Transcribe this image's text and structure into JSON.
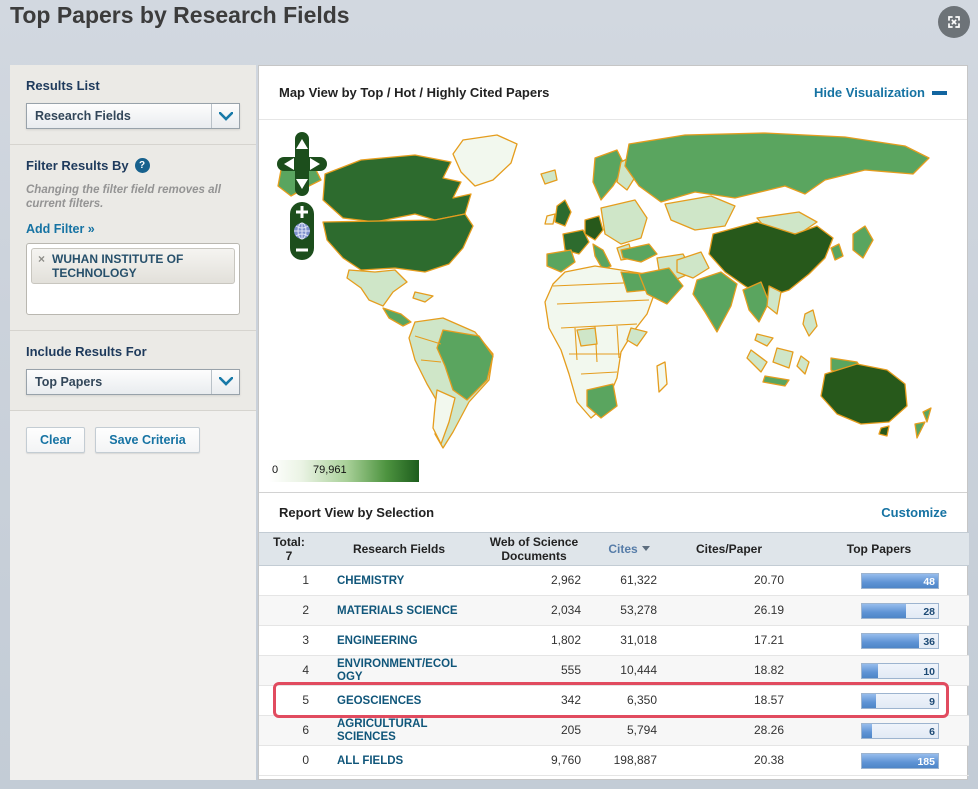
{
  "page": {
    "title": "Top Papers by Research Fields"
  },
  "theme": {
    "link": "#1673a3",
    "highlight": "#e14b5f",
    "nav-heading": "#1e3a5c",
    "field-link": "#10567a"
  },
  "icons": {
    "help": "?",
    "remove_tag": "×",
    "fullscreen": "expand-toggle",
    "hide_minus": "collapse-minus",
    "sort_desc": "triangle-down",
    "chevron_down": "chevron-down"
  },
  "sidebar": {
    "results_list": {
      "heading": "Results List",
      "selected": "Research Fields"
    },
    "filter": {
      "heading": "Filter Results By",
      "note": "Changing the filter field removes all current filters.",
      "add_filter_label": "Add Filter »",
      "tags": [
        {
          "remove_glyph": "×",
          "label": "WUHAN INSTITUTE OF TECHNOLOGY"
        }
      ]
    },
    "include": {
      "heading": "Include Results For",
      "selected": "Top Papers"
    },
    "actions": {
      "clear_label": "Clear",
      "save_label": "Save Criteria"
    }
  },
  "visualization": {
    "title": "Map View by Top / Hot / Highly Cited Papers",
    "hide_label": "Hide Visualization",
    "legend": {
      "min": "0",
      "max": "79,961"
    },
    "map_colors": {
      "level0": "#f2f8ee",
      "level1": "#cfe6c8",
      "level2": "#5aa55f",
      "level3": "#2d6b2e",
      "level4": "#27591b",
      "border": "#e59d1e"
    }
  },
  "report": {
    "title": "Report View by Selection",
    "customize_label": "Customize",
    "table": {
      "total_label": "Total:",
      "total_value": "7",
      "columns": {
        "field": "Research Fields",
        "wos": "Web of Science Documents",
        "cites": "Cites",
        "cpp": "Cites/Paper",
        "top": "Top Papers"
      },
      "sorted_by": "Cites",
      "rows": [
        {
          "rank": "1",
          "field": "CHEMISTRY",
          "wos_documents": "2,962",
          "cites": "61,322",
          "cites_per_paper": "20.70",
          "top_papers": "48",
          "bar_pct": 100,
          "highlighted": false
        },
        {
          "rank": "2",
          "field": "MATERIALS SCIENCE",
          "wos_documents": "2,034",
          "cites": "53,278",
          "cites_per_paper": "26.19",
          "top_papers": "28",
          "bar_pct": 58,
          "highlighted": false
        },
        {
          "rank": "3",
          "field": "ENGINEERING",
          "wos_documents": "1,802",
          "cites": "31,018",
          "cites_per_paper": "17.21",
          "top_papers": "36",
          "bar_pct": 75,
          "highlighted": false
        },
        {
          "rank": "4",
          "field": "ENVIRONMENT/ECOLOGY",
          "wos_documents": "555",
          "cites": "10,444",
          "cites_per_paper": "18.82",
          "top_papers": "10",
          "bar_pct": 21,
          "highlighted": false
        },
        {
          "rank": "5",
          "field": "GEOSCIENCES",
          "wos_documents": "342",
          "cites": "6,350",
          "cites_per_paper": "18.57",
          "top_papers": "9",
          "bar_pct": 19,
          "highlighted": true
        },
        {
          "rank": "6",
          "field": "AGRICULTURAL SCIENCES",
          "wos_documents": "205",
          "cites": "5,794",
          "cites_per_paper": "28.26",
          "top_papers": "6",
          "bar_pct": 13,
          "highlighted": false
        },
        {
          "rank": "0",
          "field": "ALL FIELDS",
          "wos_documents": "9,760",
          "cites": "198,887",
          "cites_per_paper": "20.38",
          "top_papers": "185",
          "bar_pct": 100,
          "highlighted": false
        }
      ]
    }
  }
}
